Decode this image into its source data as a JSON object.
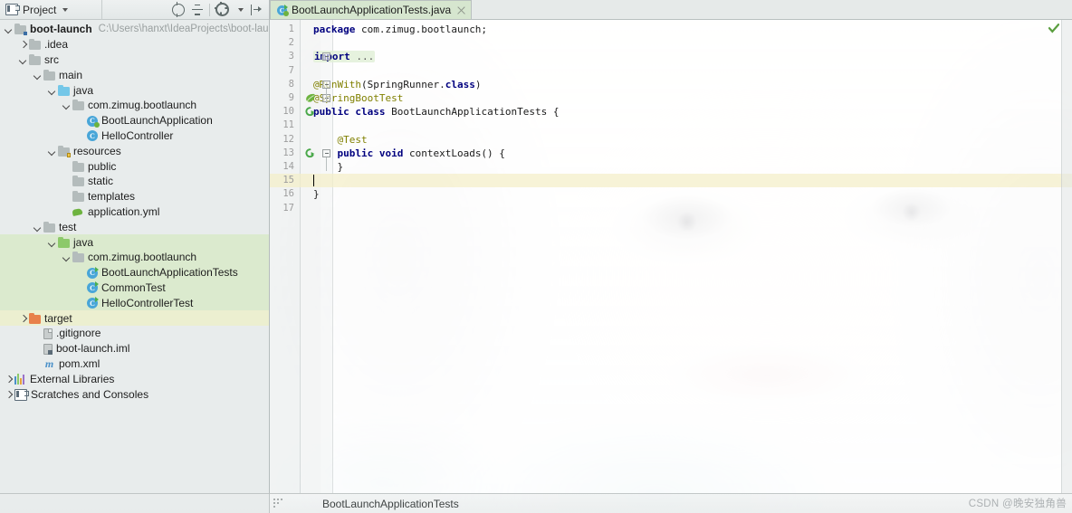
{
  "project_panel": {
    "header": {
      "title": "Project",
      "dropdown_icon": "chevron-down-icon",
      "tools": [
        {
          "name": "locate-in-tree-icon",
          "tooltip": "Select Opened File"
        },
        {
          "name": "collapse-all-icon",
          "tooltip": "Collapse All"
        },
        {
          "name": "settings-gear-icon",
          "tooltip": "Show Options Menu"
        },
        {
          "name": "hide-panel-icon",
          "tooltip": "Hide"
        }
      ]
    },
    "tree": [
      {
        "label": "boot-launch",
        "path": "C:\\Users\\hanxt\\IdeaProjects\\boot-launch",
        "indent": 0,
        "arrow": "down",
        "icon": "module-folder-icon",
        "bold": true,
        "highlight": ""
      },
      {
        "label": ".idea",
        "path": "",
        "indent": 1,
        "arrow": "right",
        "icon": "folder-icon",
        "bold": false,
        "highlight": ""
      },
      {
        "label": "src",
        "path": "",
        "indent": 1,
        "arrow": "down",
        "icon": "folder-icon",
        "bold": false,
        "highlight": ""
      },
      {
        "label": "main",
        "path": "",
        "indent": 2,
        "arrow": "down",
        "icon": "folder-icon",
        "bold": false,
        "highlight": ""
      },
      {
        "label": "java",
        "path": "",
        "indent": 3,
        "arrow": "down",
        "icon": "sources-root-folder-icon",
        "bold": false,
        "highlight": ""
      },
      {
        "label": "com.zimug.bootlaunch",
        "path": "",
        "indent": 4,
        "arrow": "down",
        "icon": "package-folder-icon",
        "bold": false,
        "highlight": ""
      },
      {
        "label": "BootLaunchApplication",
        "path": "",
        "indent": 5,
        "arrow": "none",
        "icon": "spring-class-icon",
        "bold": false,
        "highlight": ""
      },
      {
        "label": "HelloController",
        "path": "",
        "indent": 5,
        "arrow": "none",
        "icon": "class-icon",
        "bold": false,
        "highlight": ""
      },
      {
        "label": "resources",
        "path": "",
        "indent": 3,
        "arrow": "down",
        "icon": "resources-root-folder-icon",
        "bold": false,
        "highlight": ""
      },
      {
        "label": "public",
        "path": "",
        "indent": 4,
        "arrow": "none",
        "icon": "package-folder-icon",
        "bold": false,
        "highlight": ""
      },
      {
        "label": "static",
        "path": "",
        "indent": 4,
        "arrow": "none",
        "icon": "package-folder-icon",
        "bold": false,
        "highlight": ""
      },
      {
        "label": "templates",
        "path": "",
        "indent": 4,
        "arrow": "none",
        "icon": "package-folder-icon",
        "bold": false,
        "highlight": ""
      },
      {
        "label": "application.yml",
        "path": "",
        "indent": 4,
        "arrow": "none",
        "icon": "yaml-spring-icon",
        "bold": false,
        "highlight": ""
      },
      {
        "label": "test",
        "path": "",
        "indent": 2,
        "arrow": "down",
        "icon": "folder-icon",
        "bold": false,
        "highlight": ""
      },
      {
        "label": "java",
        "path": "",
        "indent": 3,
        "arrow": "down",
        "icon": "test-sources-root-folder-icon",
        "bold": false,
        "highlight": "test"
      },
      {
        "label": "com.zimug.bootlaunch",
        "path": "",
        "indent": 4,
        "arrow": "down",
        "icon": "package-folder-icon",
        "bold": false,
        "highlight": "test"
      },
      {
        "label": "BootLaunchApplicationTests",
        "path": "",
        "indent": 5,
        "arrow": "none",
        "icon": "runnable-test-class-icon",
        "bold": false,
        "highlight": "test"
      },
      {
        "label": "CommonTest",
        "path": "",
        "indent": 5,
        "arrow": "none",
        "icon": "runnable-test-class-icon",
        "bold": false,
        "highlight": "test"
      },
      {
        "label": "HelloControllerTest",
        "path": "",
        "indent": 5,
        "arrow": "none",
        "icon": "runnable-test-class-icon",
        "bold": false,
        "highlight": "test"
      },
      {
        "label": "target",
        "path": "",
        "indent": 1,
        "arrow": "right",
        "icon": "excluded-folder-icon",
        "bold": false,
        "highlight": "target"
      },
      {
        "label": ".gitignore",
        "path": "",
        "indent": 2,
        "arrow": "none",
        "icon": "file-icon",
        "bold": false,
        "highlight": ""
      },
      {
        "label": "boot-launch.iml",
        "path": "",
        "indent": 2,
        "arrow": "none",
        "icon": "iml-file-icon",
        "bold": false,
        "highlight": ""
      },
      {
        "label": "pom.xml",
        "path": "",
        "indent": 2,
        "arrow": "none",
        "icon": "maven-pom-icon",
        "bold": false,
        "highlight": ""
      },
      {
        "label": "External Libraries",
        "path": "",
        "indent": 0,
        "arrow": "right",
        "icon": "external-libraries-icon",
        "bold": false,
        "highlight": ""
      },
      {
        "label": "Scratches and Consoles",
        "path": "",
        "indent": 0,
        "arrow": "right",
        "icon": "scratches-icon",
        "bold": false,
        "highlight": ""
      }
    ]
  },
  "editor": {
    "tab": {
      "label": "BootLaunchApplicationTests.java",
      "icon": "runnable-test-class-icon",
      "close_icon": "close-icon",
      "active": true
    },
    "inspection_status": "ok",
    "inspection_icon": "green-check-icon",
    "current_line": 15,
    "lines": [
      {
        "num": "1",
        "segments": [
          {
            "t": "package",
            "c": "kw"
          },
          {
            "t": " com.zimug.bootlaunch;",
            "c": "plain"
          }
        ],
        "gutter": "",
        "fold": "",
        "current": false
      },
      {
        "num": "2",
        "segments": [],
        "gutter": "",
        "fold": "",
        "current": false
      },
      {
        "num": "3",
        "segments": [
          {
            "t": "import",
            "c": "kw"
          },
          {
            "t": " ...",
            "c": "fold-dots"
          }
        ],
        "gutter": "",
        "fold": "collapsed",
        "current": false
      },
      {
        "num": "7",
        "segments": [],
        "gutter": "",
        "fold": "",
        "current": false
      },
      {
        "num": "8",
        "segments": [
          {
            "t": "@RunWith",
            "c": "ann"
          },
          {
            "t": "(SpringRunner.",
            "c": "plain"
          },
          {
            "t": "class",
            "c": "kw"
          },
          {
            "t": ")",
            "c": "plain"
          }
        ],
        "gutter": "",
        "fold": "expanded-top",
        "current": false
      },
      {
        "num": "9",
        "segments": [
          {
            "t": "@SpringBootTest",
            "c": "ann"
          }
        ],
        "gutter": "spring-leaf-icon",
        "fold": "expanded-mid",
        "current": false
      },
      {
        "num": "10",
        "segments": [
          {
            "t": "public class",
            "c": "kw"
          },
          {
            "t": " BootLaunchApplicationTests {",
            "c": "plain"
          }
        ],
        "gutter": "run-test-icon",
        "fold": "",
        "current": false
      },
      {
        "num": "11",
        "segments": [],
        "gutter": "",
        "fold": "",
        "current": false
      },
      {
        "num": "12",
        "segments": [
          {
            "t": "    @Test",
            "c": "ann"
          }
        ],
        "gutter": "",
        "fold": "",
        "current": false
      },
      {
        "num": "13",
        "segments": [
          {
            "t": "    public void",
            "c": "kw"
          },
          {
            "t": " contextLoads() {",
            "c": "plain"
          }
        ],
        "gutter": "run-test-icon",
        "fold": "collapsed",
        "current": false
      },
      {
        "num": "14",
        "segments": [
          {
            "t": "    }",
            "c": "plain"
          }
        ],
        "gutter": "",
        "fold": "",
        "current": false
      },
      {
        "num": "15",
        "segments": [],
        "gutter": "",
        "fold": "",
        "current": true
      },
      {
        "num": "16",
        "segments": [
          {
            "t": "}",
            "c": "plain"
          }
        ],
        "gutter": "",
        "fold": "",
        "current": false
      },
      {
        "num": "17",
        "segments": [],
        "gutter": "",
        "fold": "",
        "current": false
      }
    ]
  },
  "statusbar": {
    "breadcrumb": "BootLaunchApplicationTests",
    "watermark": "CSDN @晚安独角兽"
  },
  "colors": {
    "panel_bg": "#e8ecec",
    "test_highlight": "#dbeace",
    "target_highlight": "#ecefd0",
    "tab_active": "#d6e6cf",
    "keyword": "#00007f",
    "annotation": "#808000",
    "current_line": "#f4eec8",
    "spring_green": "#6db33f",
    "sources_blue": "#74c7e8",
    "test_sources_green": "#8cc96a",
    "excluded_orange": "#e8804a"
  }
}
